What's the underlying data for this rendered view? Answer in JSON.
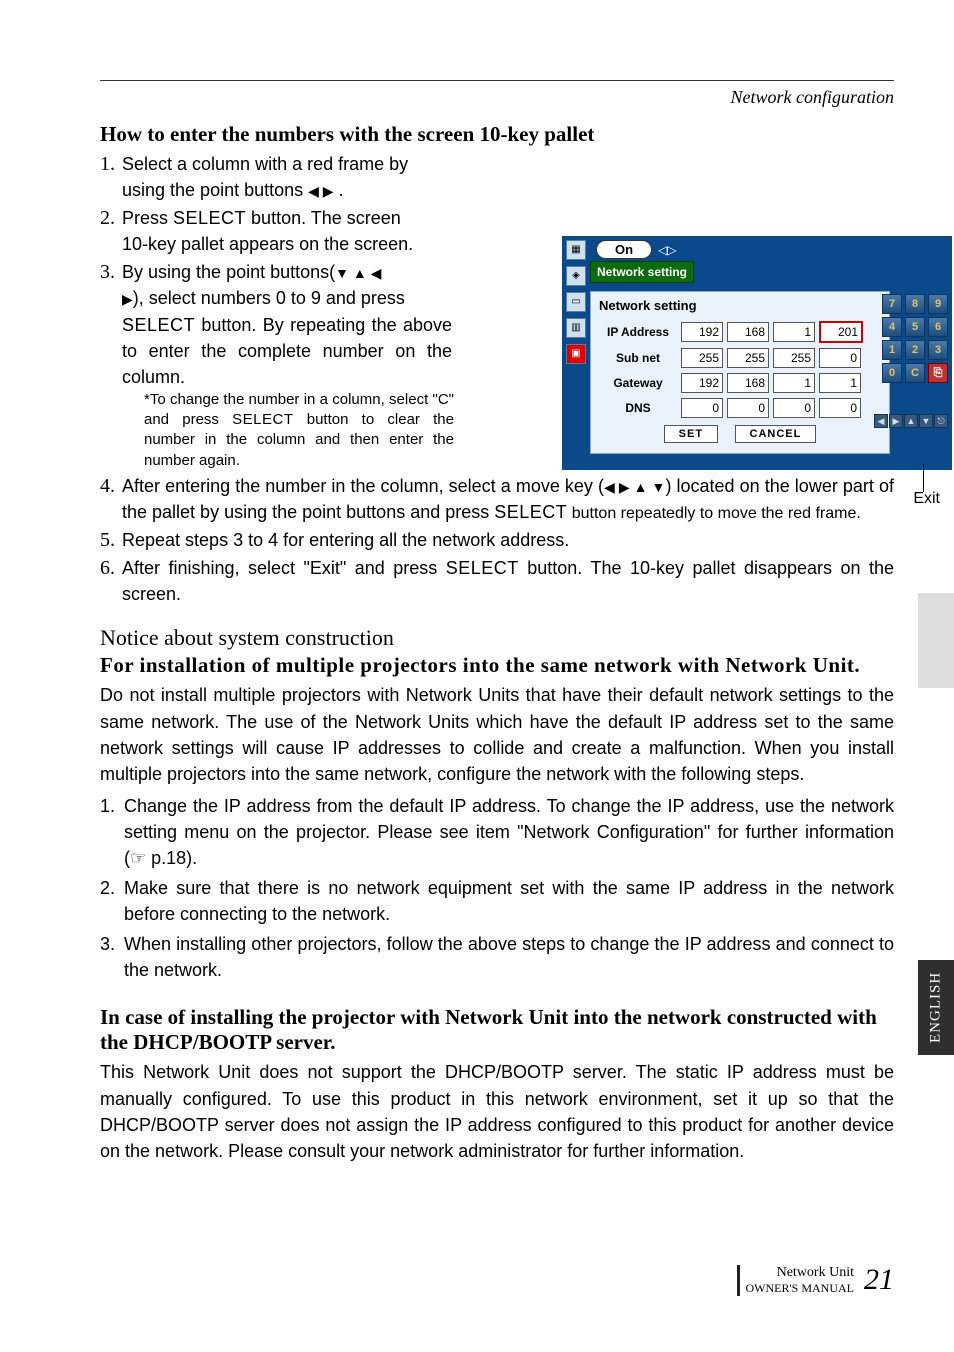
{
  "header": {
    "section": "Network configuration"
  },
  "h_pallet_title": "How to enter the numbers with the screen 10-key pallet",
  "steps": {
    "s1a": "Select a column with a red frame by",
    "s1b": "using the point buttons ",
    "s1c": " .",
    "s2a": "Press ",
    "s2b": " button. The screen",
    "s2c": "10-key pallet appears on the screen.",
    "s3a": "By using the point buttons(",
    "s3b": "), select numbers 0 to 9 and press ",
    "s3c": " button. By repeating the above to enter the complete number on the column.",
    "s3note_a": "*To change the number in a column, select \"C\" and press ",
    "s3note_b": " button to clear the number in the column and then enter the number again.",
    "s4a": "After entering the number in the column, select a move key (",
    "s4b": ") located on the lower part of the pallet by using the point buttons and press ",
    "s4c": " button repeatedly to move the red frame.",
    "s5": "Repeat steps 3 to 4 for entering all the network address.",
    "s6a": "After finishing, select \"Exit\" and press ",
    "s6b": " button. The 10-key pallet disappears on the screen."
  },
  "select_label": "SELECT",
  "arrows": {
    "lr": "◀ ▶",
    "udlr_triplet": "▼ ▲ ◀",
    "right": "▶",
    "lrud": "◀ ▶ ▲ ▼"
  },
  "notice_title": "Notice about system construction",
  "notice_sub1": "For installation of multiple projectors into the same network with Network Unit.",
  "notice_p1": "Do not install multiple projectors with Network Units that have their default network settings to the same network. The use of the Network Units which have the default IP address set to the same network settings will cause IP addresses to collide and create a malfunction. When you install multiple projectors into the same network, configure the network with the following steps.",
  "notice_steps": {
    "n1": "Change the IP address from the default IP address. To change the IP address, use the network setting menu on the projector. Please see item \"Network Configuration\" for further information (☞ p.18).",
    "n2": "Make sure that there is no network equipment set with the same IP address in the network before connecting to the network.",
    "n3": "When installing other projectors, follow the above steps to change the IP address and connect to the network."
  },
  "notice_sub2": "In case of installing the projector with Network Unit into the network constructed with the DHCP/BOOTP server.",
  "notice_p2": "This Network Unit does not support the DHCP/BOOTP server. The static IP address must be manually configured. To use this product in this network environment, set it up so that the DHCP/BOOTP server does not assign the IP address configured to this product for another device on the network. Please consult your network administrator for further information.",
  "side_tab": "ENGLISH",
  "footer": {
    "line1": "Network Unit",
    "line2": "OWNER'S MANUAL",
    "page": "21"
  },
  "osd": {
    "top_on": "On",
    "top_sel": "Network setting",
    "panel_title": "Network setting",
    "rows": [
      {
        "label": "IP Address",
        "o": [
          "192",
          "168",
          "1",
          "201"
        ],
        "sel": 3
      },
      {
        "label": "Sub net",
        "o": [
          "255",
          "255",
          "255",
          "0"
        ]
      },
      {
        "label": "Gateway",
        "o": [
          "192",
          "168",
          "1",
          "1"
        ]
      },
      {
        "label": "DNS",
        "o": [
          "0",
          "0",
          "0",
          "0"
        ]
      }
    ],
    "set": "SET",
    "cancel": "CANCEL",
    "label_keypad": "10-key pallet",
    "label_exit": "Exit",
    "keys": [
      "7",
      "8",
      "9",
      "4",
      "5",
      "6",
      "1",
      "2",
      "3",
      "0",
      "C",
      "⎘"
    ],
    "key_sel_index": 11,
    "nav": [
      "◀",
      "▶",
      "▲",
      "▼",
      "⎋"
    ]
  }
}
